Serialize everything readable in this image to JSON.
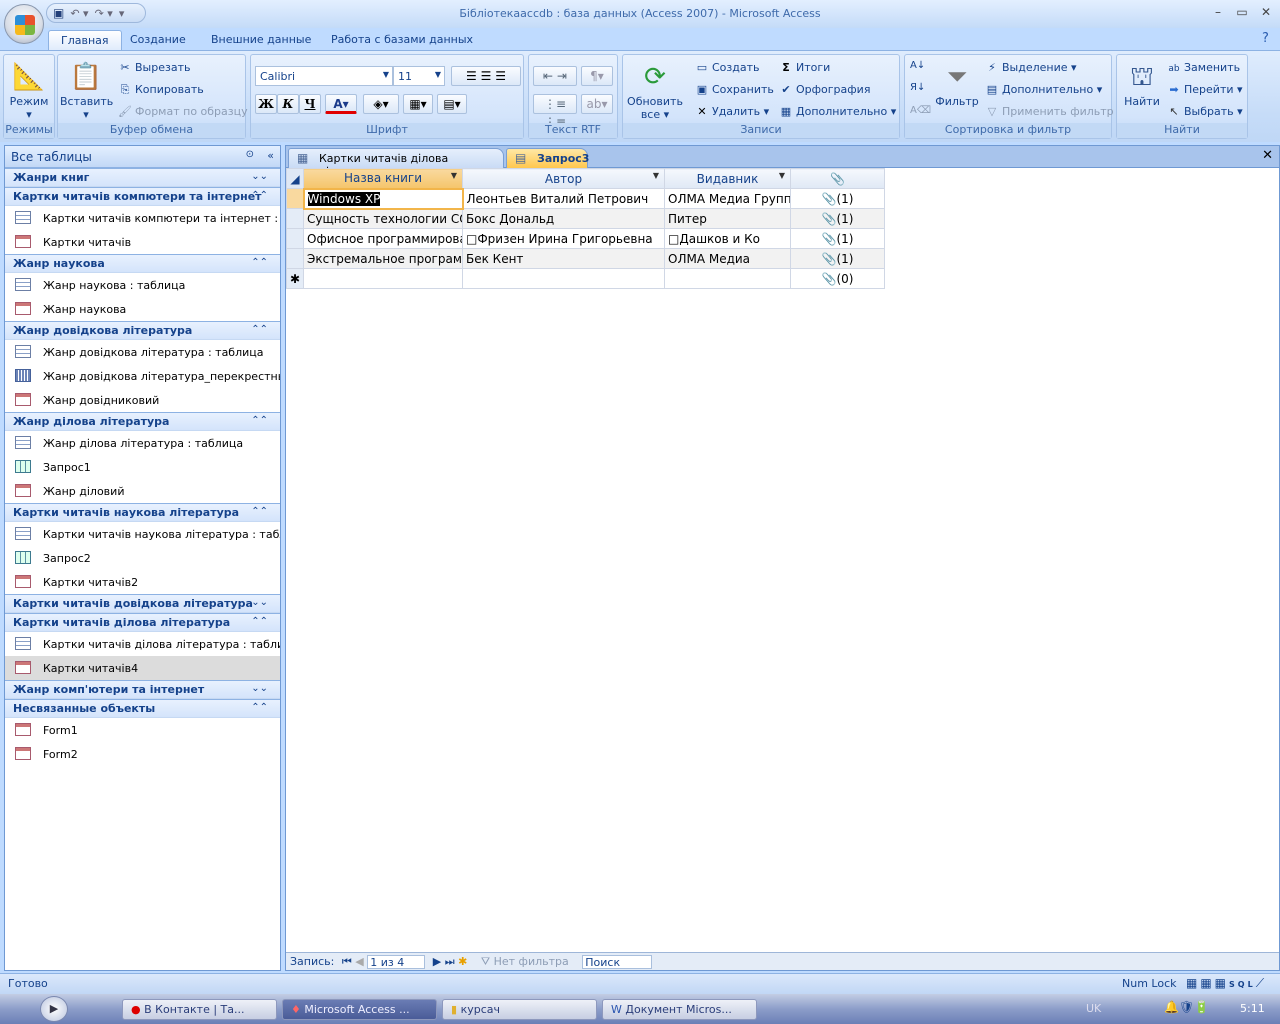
{
  "window": {
    "title": "Бібліотекаaccdb : база данных (Access 2007) - Microsoft Access"
  },
  "qat": {
    "save": "save-icon",
    "undo": "↶ ▾",
    "redo": "↷ ▾",
    "more": "▾"
  },
  "ribbon_tabs": [
    "Главная",
    "Создание",
    "Внешние данные",
    "Работа с базами данных"
  ],
  "ribbon": {
    "modes": {
      "button": "Режим",
      "label": "Режимы"
    },
    "clipboard": {
      "paste": "Вставить",
      "cut": "Вырезать",
      "copy": "Копировать",
      "format": "Формат по образцу",
      "label": "Буфер обмена"
    },
    "font": {
      "font_name": "Calibri",
      "font_size": "11",
      "bold": "Ж",
      "italic": "К",
      "underline": "Ч",
      "label": "Шрифт",
      "font_color": "#e00000"
    },
    "rtf": {
      "label": "Текст RTF"
    },
    "records": {
      "refresh": "Обновить",
      "refresh2": "все ▾",
      "new": "Создать",
      "save": "Сохранить",
      "delete": "Удалить ▾",
      "totals": "Итоги",
      "spelling": "Орфография",
      "more": "Дополнительно ▾",
      "label": "Записи"
    },
    "sort": {
      "filter": "Фильтр",
      "selection": "Выделение ▾",
      "advanced": "Дополнительно ▾",
      "toggle": "Применить фильтр",
      "label": "Сортировка и фильтр"
    },
    "find": {
      "find": "Найти",
      "replace": "Заменить",
      "goto": "Перейти ▾",
      "select": "Выбрать ▾",
      "label": "Найти"
    }
  },
  "nav": {
    "title": "Все таблицы",
    "groups": [
      {
        "name": "Жанри книг",
        "collapsed": true,
        "items": []
      },
      {
        "name": "Картки читачів компютери та інтернет",
        "items": [
          {
            "t": "table",
            "label": "Картки читачів компютери та інтернет : ..."
          },
          {
            "t": "form",
            "label": "Картки читачів"
          }
        ]
      },
      {
        "name": "Жанр наукова",
        "items": [
          {
            "t": "table",
            "label": "Жанр наукова : таблица"
          },
          {
            "t": "form",
            "label": "Жанр наукова"
          }
        ]
      },
      {
        "name": "Жанр довідкова література",
        "items": [
          {
            "t": "table",
            "label": "Жанр довідкова література : таблица"
          },
          {
            "t": "cross",
            "label": "Жанр довідкова література_перекрестный"
          },
          {
            "t": "form",
            "label": "Жанр довідниковий"
          }
        ]
      },
      {
        "name": "Жанр ділова література",
        "items": [
          {
            "t": "table",
            "label": "Жанр ділова література : таблица"
          },
          {
            "t": "query",
            "label": "Запрос1"
          },
          {
            "t": "form",
            "label": "Жанр діловий"
          }
        ]
      },
      {
        "name": "Картки читачів наукова література",
        "items": [
          {
            "t": "table",
            "label": "Картки читачів наукова література : табл..."
          },
          {
            "t": "query",
            "label": "Запрос2"
          },
          {
            "t": "form",
            "label": "Картки читачів2"
          }
        ]
      },
      {
        "name": "Картки читачів довідкова література",
        "collapsed": true,
        "items": []
      },
      {
        "name": "Картки читачів ділова література",
        "items": [
          {
            "t": "table",
            "label": "Картки читачів ділова література : таблица"
          },
          {
            "t": "form",
            "label": "Картки читачів4",
            "selected": true
          }
        ]
      },
      {
        "name": "Жанр комп'ютери та інтернет",
        "collapsed": true,
        "items": []
      },
      {
        "name": "Несвязанные объекты",
        "items": [
          {
            "t": "form",
            "label": "Form1"
          },
          {
            "t": "form",
            "label": "Form2"
          }
        ]
      }
    ]
  },
  "doc_tabs": [
    {
      "label": "Картки читачів ділова література",
      "active": false
    },
    {
      "label": "Запрос3",
      "active": true
    }
  ],
  "grid": {
    "columns": [
      "Назва книги",
      "Автор",
      "Видавник",
      "attachment-icon"
    ],
    "rows": [
      [
        "Windows XP",
        "Леонтьев Виталий Петрович",
        "ОЛМА Медиа Групп",
        "(1)"
      ],
      [
        "Сущность технологии СОМ",
        "Бокс Дональд",
        "Питер",
        "(1)"
      ],
      [
        "Офисное программирование",
        "□Фризен Ирина Григорьевна",
        "□Дашков и Ко",
        "(1)"
      ],
      [
        "Экстремальное программирование",
        "Бек Кент",
        "ОЛМА Медиа",
        "(1)"
      ]
    ],
    "new_row": "(0)"
  },
  "recnav": {
    "label": "Запись:",
    "position": "1 из 4",
    "filter": "Нет фильтра",
    "search": "Поиск"
  },
  "status": {
    "left": "Готово",
    "numlock": "Num Lock",
    "views": "SQL"
  },
  "taskbar": {
    "items": [
      "В Контакте | Та...",
      "Microsoft Access ...",
      "курсач",
      "Документ Micros..."
    ],
    "lang": "UK",
    "clock": "5:11"
  }
}
